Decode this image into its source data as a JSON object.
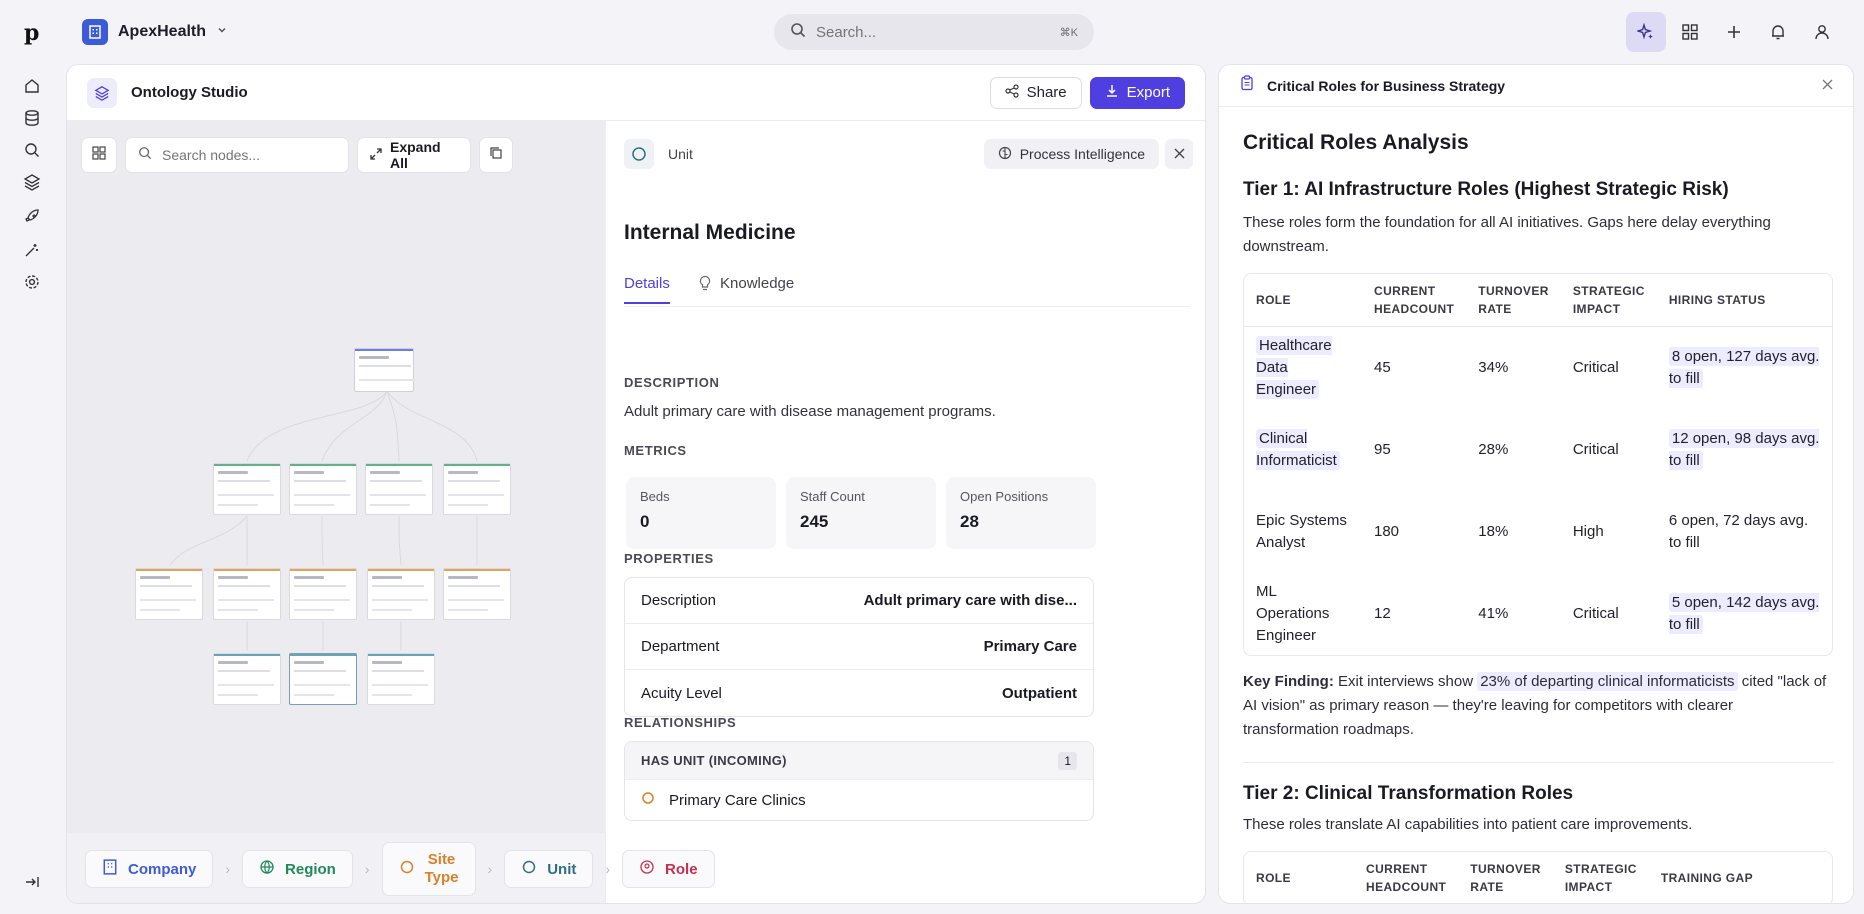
{
  "org": {
    "name": "ApexHealth"
  },
  "search": {
    "placeholder": "Search...",
    "shortcut": "⌘K"
  },
  "studio": {
    "title": "Ontology Studio",
    "share_label": "Share",
    "export_label": "Export",
    "canvas": {
      "search_placeholder": "Search nodes...",
      "expand_label": "Expand All"
    },
    "breadcrumbs": [
      {
        "label": "Company",
        "color": "#3d5bd9"
      },
      {
        "label": "Region",
        "color": "#1f8a57"
      },
      {
        "label": "Site Type",
        "color": "#d9802a"
      },
      {
        "label": "Unit",
        "color": "#2f6f86"
      },
      {
        "label": "Role",
        "color": "#c4304f"
      }
    ]
  },
  "details": {
    "type_label": "Unit",
    "process_label": "Process Intelligence",
    "title": "Internal Medicine",
    "tabs": [
      {
        "label": "Details"
      },
      {
        "label": "Knowledge"
      }
    ],
    "description_label": "DESCRIPTION",
    "description": "Adult primary care with disease management programs.",
    "metrics_label": "METRICS",
    "metrics": [
      {
        "label": "Beds",
        "value": "0"
      },
      {
        "label": "Staff Count",
        "value": "245"
      },
      {
        "label": "Open Positions",
        "value": "28"
      }
    ],
    "properties_label": "PROPERTIES",
    "properties": [
      {
        "key": "Description",
        "value": "Adult primary care with dise..."
      },
      {
        "key": "Department",
        "value": "Primary Care"
      },
      {
        "key": "Acuity Level",
        "value": "Outpatient"
      }
    ],
    "relationships_label": "RELATIONSHIPS",
    "relationship": {
      "label": "HAS UNIT (INCOMING)",
      "count": "1",
      "item": "Primary Care Clinics"
    }
  },
  "analysis": {
    "panel_title": "Critical Roles for Business Strategy",
    "heading": "Critical Roles Analysis",
    "tier1": {
      "title": "Tier 1: AI Infrastructure Roles (Highest Strategic Risk)",
      "intro": "These roles form the foundation for all AI initiatives. Gaps here delay everything downstream.",
      "headers": [
        "ROLE",
        "CURRENT HEADCOUNT",
        "TURNOVER RATE",
        "STRATEGIC IMPACT",
        "HIRING STATUS"
      ],
      "rows": [
        {
          "role": "Healthcare Data Engineer",
          "headcount": "45",
          "turnover": "34%",
          "impact": "Critical",
          "status": "8 open, 127 days avg. to fill"
        },
        {
          "role": "Clinical Informaticist",
          "headcount": "95",
          "turnover": "28%",
          "impact": "Critical",
          "status": "12 open, 98 days avg. to fill"
        },
        {
          "role": "Epic Systems Analyst",
          "headcount": "180",
          "turnover": "18%",
          "impact": "High",
          "status": "6 open, 72 days avg. to fill"
        },
        {
          "role": "ML Operations Engineer",
          "headcount": "12",
          "turnover": "41%",
          "impact": "Critical",
          "status": "5 open, 142 days avg. to fill"
        }
      ]
    },
    "key_finding": {
      "label": "Key Finding:",
      "before": "Exit interviews show",
      "highlight": "23% of departing clinical informaticists",
      "after": "cited \"lack of AI vision\" as primary reason — they're leaving for competitors with clearer transformation roadmaps."
    },
    "tier2": {
      "title": "Tier 2: Clinical Transformation Roles",
      "intro": "These roles translate AI capabilities into patient care improvements.",
      "headers": [
        "ROLE",
        "CURRENT HEADCOUNT",
        "TURNOVER RATE",
        "STRATEGIC IMPACT",
        "TRAINING GAP"
      ]
    }
  }
}
